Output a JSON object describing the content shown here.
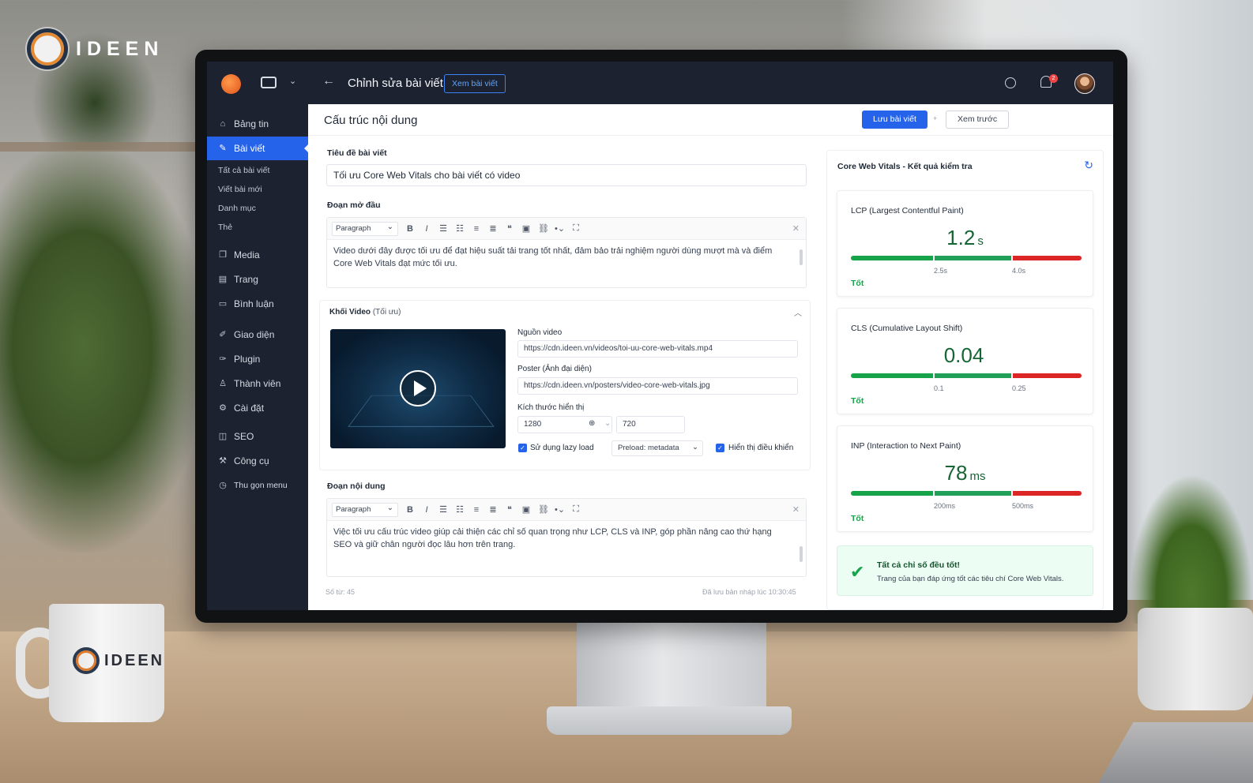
{
  "brand": {
    "name": "IDEEN"
  },
  "mug": {
    "brand": "IDEEN"
  },
  "topbar": {
    "back_icon": "arrow-left-icon",
    "title": "Chỉnh sửa bài viết",
    "view_post": "Xem bài viết",
    "notification_count": "2"
  },
  "sidebar": {
    "items": [
      {
        "label": "Bảng tin",
        "icon": "home-icon"
      },
      {
        "label": "Bài viết",
        "icon": "pencil-icon"
      },
      {
        "label": "Media",
        "icon": "media-icon"
      },
      {
        "label": "Trang",
        "icon": "page-icon"
      },
      {
        "label": "Bình luận",
        "icon": "comment-icon"
      },
      {
        "label": "Giao diện",
        "icon": "brush-icon"
      },
      {
        "label": "Plugin",
        "icon": "plugin-icon"
      },
      {
        "label": "Thành viên",
        "icon": "user-icon"
      },
      {
        "label": "Cài đặt",
        "icon": "gear-icon"
      },
      {
        "label": "SEO",
        "icon": "seo-icon"
      },
      {
        "label": "Công cụ",
        "icon": "wrench-icon"
      },
      {
        "label": "Thu gọn menu",
        "icon": "collapse-icon"
      }
    ],
    "subitems": [
      "Tất cả bài viết",
      "Viết bài mới",
      "Danh mục",
      "Thẻ"
    ]
  },
  "main": {
    "heading": "Cấu trúc nội dung",
    "save": "Lưu bài viết",
    "plus": "+",
    "preview": "Xem trước",
    "title_label": "Tiêu đề bài viết",
    "title_value": "Tối ưu Core Web Vitals cho bài viết có video",
    "intro_label": "Đoạn mở đầu",
    "paragraph_select": "Paragraph",
    "intro_text": "Video dưới đây được tối ưu để đạt hiệu suất tải trang tốt nhất, đảm bảo trải nghiệm người dùng mượt mà và điểm Core Web Vitals đạt mức tối ưu.",
    "video_block": {
      "heading": "Khối Video",
      "heading_note": "(Tối ưu)",
      "source_label": "Nguồn video",
      "source_value": "https://cdn.ideen.vn/videos/toi-uu-core-web-vitals.mp4",
      "poster_label": "Poster (Ảnh đại diện)",
      "poster_value": "https://cdn.ideen.vn/posters/video-core-web-vitals.jpg",
      "size_label": "Kích thước hiển thị",
      "width": "1280",
      "link_symbol": "⊕",
      "height": "720",
      "lazy_label": "Sử dụng lazy load",
      "preload": "Preload: metadata",
      "controls_label": "Hiển thị điều khiển"
    },
    "content_label": "Đoạn nội dung",
    "content_text": "Việc tối ưu cấu trúc video giúp cải thiện các chỉ số quan trọng như LCP, CLS và INP, góp phần nâng cao thứ hạng SEO và giữ chân người đọc lâu hơn trên trang.",
    "word_count": "Số từ: 45",
    "draft_saved": "Đã lưu bản nháp lúc 10:30:45"
  },
  "cwv": {
    "heading": "Core Web Vitals - Kết quả kiểm tra",
    "metrics": [
      {
        "name": "LCP (Largest Contentful Paint)",
        "value": "1.2",
        "unit": "s",
        "t1": "2.5s",
        "t2": "4.0s",
        "status": "Tốt"
      },
      {
        "name": "CLS (Cumulative Layout Shift)",
        "value": "0.04",
        "unit": "",
        "t1": "0.1",
        "t2": "0.25",
        "status": "Tốt"
      },
      {
        "name": "INP (Interaction to Next Paint)",
        "value": "78",
        "unit": "ms",
        "t1": "200ms",
        "t2": "500ms",
        "status": "Tốt"
      }
    ],
    "summary_title": "Tất cả chỉ số đều tốt!",
    "summary_text": "Trang của bạn đáp ứng tốt các tiêu chí Core Web Vitals."
  },
  "colors": {
    "accent": "#2563eb",
    "good": "#16a34a",
    "bad": "#dc2626",
    "sidebar": "#1c2230"
  }
}
